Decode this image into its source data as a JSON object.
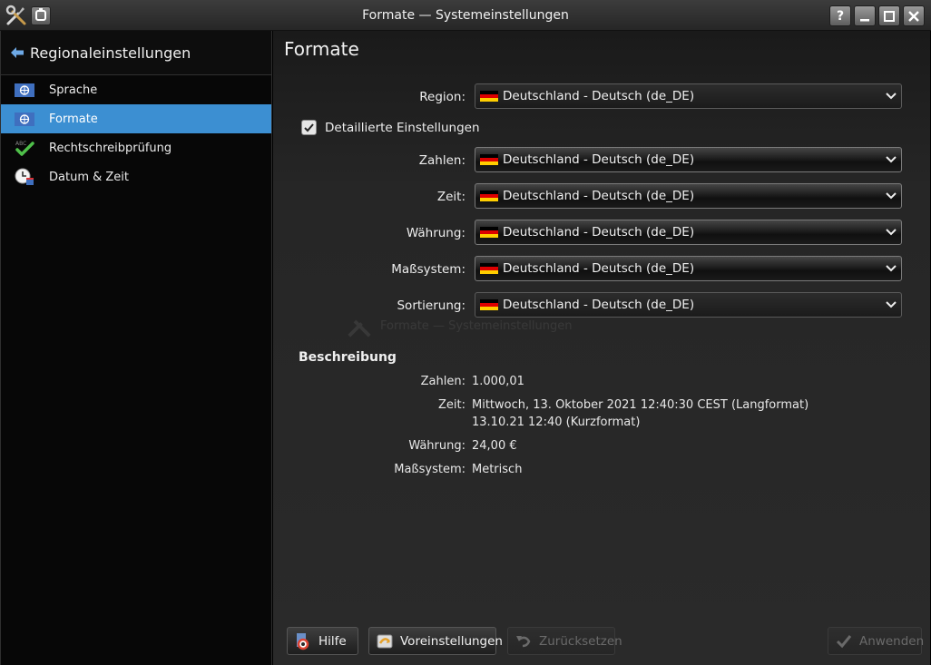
{
  "window": {
    "title": "Formate — Systemeinstellungen",
    "help_glyph": "?",
    "icons": [
      "tools-icon",
      "pin-icon",
      "help-icon",
      "minimize-icon",
      "maximize-icon",
      "close-icon"
    ]
  },
  "sidebar": {
    "header": "Regionaleinstellungen",
    "items": [
      {
        "label": "Sprache",
        "icon": "language-flag-icon",
        "active": false
      },
      {
        "label": "Formate",
        "icon": "formats-flag-icon",
        "active": true
      },
      {
        "label": "Rechtschreibprüfung",
        "icon": "spellcheck-icon",
        "active": false
      },
      {
        "label": "Datum & Zeit",
        "icon": "clock-icon",
        "active": false
      }
    ]
  },
  "main": {
    "title": "Formate",
    "region": {
      "label": "Region:",
      "value": "Deutschland - Deutsch (de_DE)"
    },
    "detailed": {
      "label": "Detaillierte Einstellungen",
      "checked": true
    },
    "settings": [
      {
        "label": "Zahlen:",
        "value": "Deutschland - Deutsch (de_DE)"
      },
      {
        "label": "Zeit:",
        "value": "Deutschland - Deutsch (de_DE)"
      },
      {
        "label": "Währung:",
        "value": "Deutschland - Deutsch (de_DE)"
      },
      {
        "label": "Maßsystem:",
        "value": "Deutschland - Deutsch (de_DE)"
      },
      {
        "label": "Sortierung:",
        "value": "Deutschland - Deutsch (de_DE)"
      }
    ],
    "watermark": {
      "title": "Formate — Systemeinstellungen"
    },
    "description": {
      "title": "Beschreibung",
      "numbers": {
        "label": "Zahlen:",
        "value": "1.000,01"
      },
      "time": {
        "label": "Zeit:",
        "value_long": "Mittwoch, 13. Oktober 2021 12:40:30 CEST (Langformat)",
        "value_short": "13.10.21 12:40 (Kurzformat)"
      },
      "currency": {
        "label": "Währung:",
        "value": "24,00 €"
      },
      "measurement": {
        "label": "Maßsystem:",
        "value": "Metrisch"
      }
    }
  },
  "buttons": {
    "help": "Hilfe",
    "defaults": "Voreinstellungen",
    "reset": "Zurücksetzen",
    "apply": "Anwenden"
  },
  "colors": {
    "accent": "#3c8fd2",
    "flag_black": "#000000",
    "flag_red": "#dd0000",
    "flag_gold": "#ffce00"
  }
}
